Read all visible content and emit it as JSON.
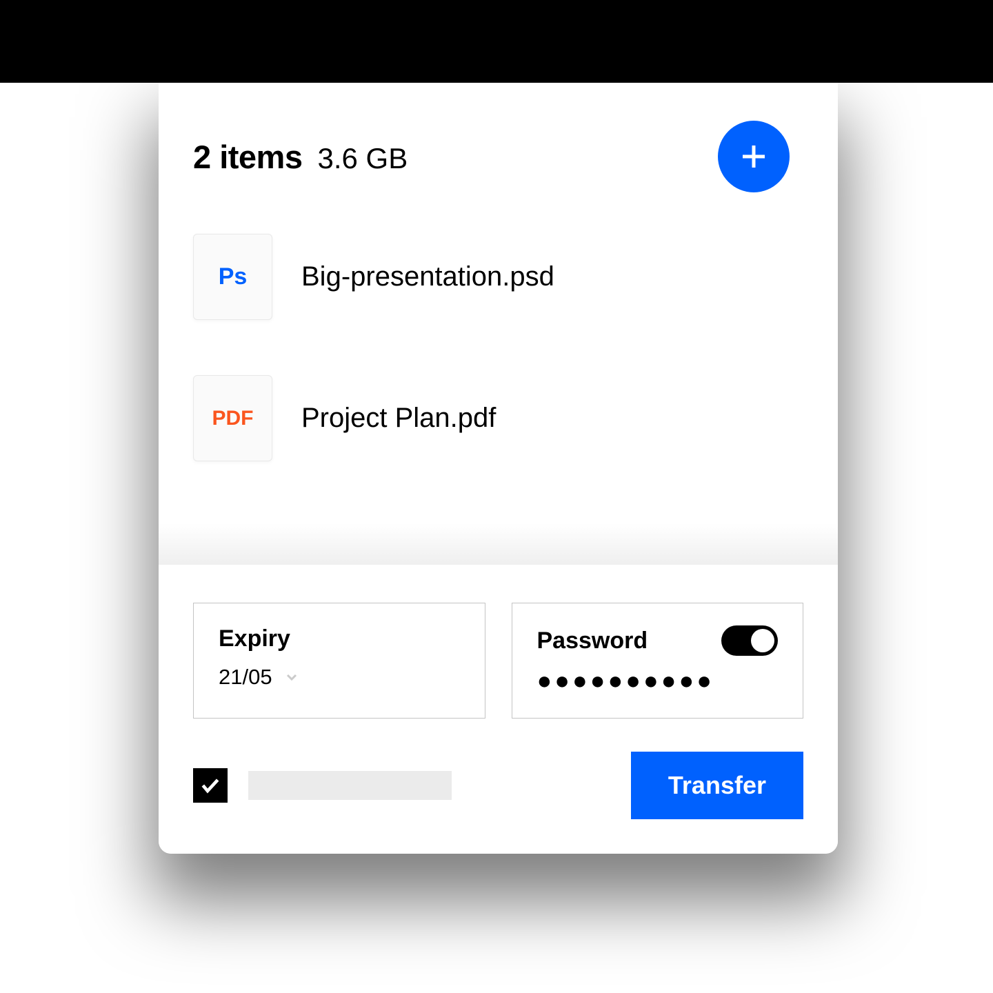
{
  "header": {
    "item_count": "2 items",
    "total_size": "3.6 GB"
  },
  "files": [
    {
      "icon_label": "Ps",
      "icon_type": "ps",
      "name": "Big-presentation.psd"
    },
    {
      "icon_label": "PDF",
      "icon_type": "pdf",
      "name": "Project Plan.pdf"
    }
  ],
  "options": {
    "expiry": {
      "label": "Expiry",
      "value": "21/05"
    },
    "password": {
      "label": "Password",
      "masked": "●●●●●●●●●●",
      "enabled": true
    }
  },
  "actions": {
    "checkbox_checked": true,
    "transfer_label": "Transfer"
  },
  "colors": {
    "primary": "#0061fe",
    "pdf": "#fa551e"
  }
}
